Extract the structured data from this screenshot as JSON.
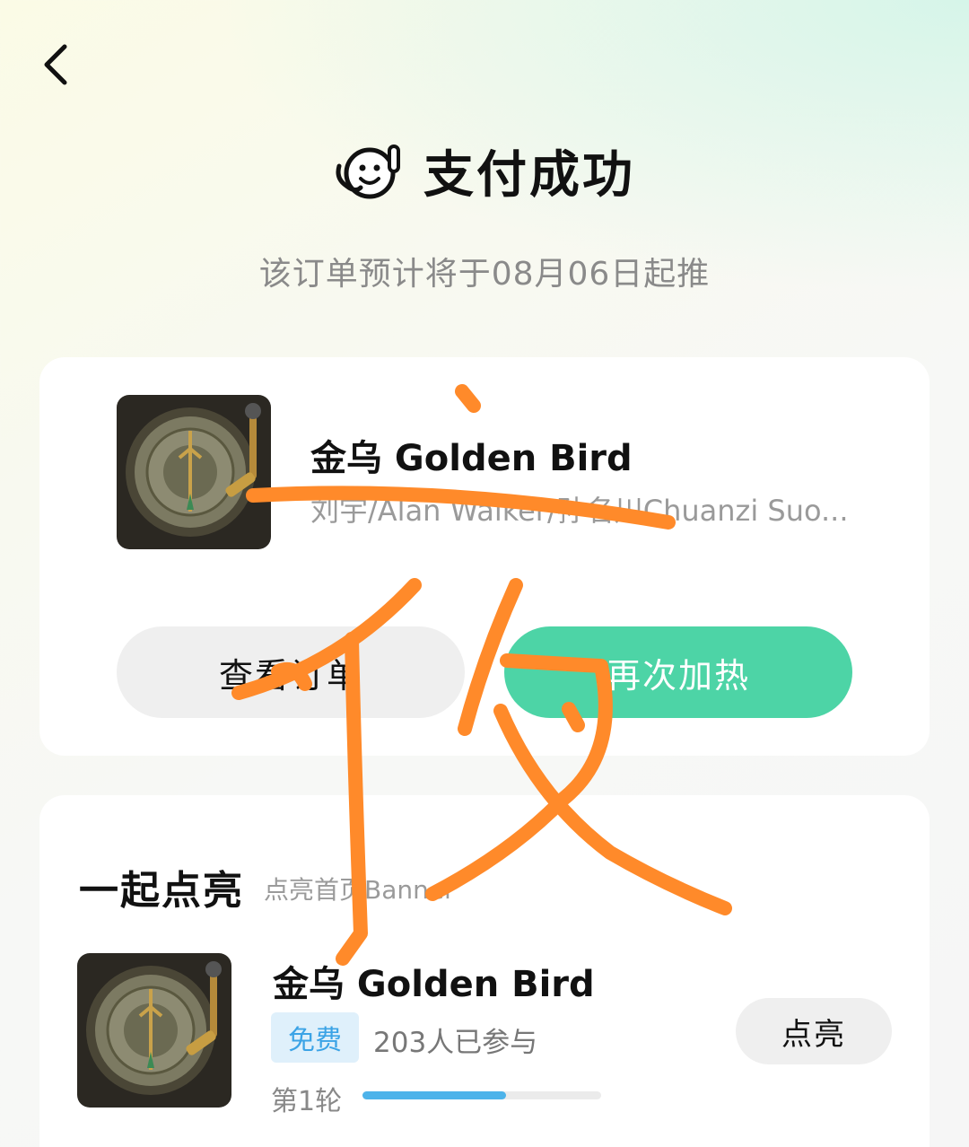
{
  "header": {
    "title": "支付成功",
    "subtitle": "该订单预计将于08月06日起推",
    "back_icon": "chevron-left-icon",
    "mascot_icon": "waving-mascot-icon"
  },
  "order": {
    "song_title": "金乌 Golden Bird",
    "artist": "刘宇/Alan Walker/孙名川Chuanzi Suo...",
    "view_button": "查看订单",
    "heat_button": "再次加热"
  },
  "light_up": {
    "title": "一起点亮",
    "subtitle": "点亮首页Banner",
    "song_title": "金乌 Golden Bird",
    "badge": "免费",
    "participants": "203人已参与",
    "round": "第1轮",
    "progress": 0.6,
    "button": "点亮"
  },
  "colors": {
    "accent_green": "#4dd4a6",
    "badge_blue": "#3ba3e6",
    "progress_blue": "#4db3ea",
    "scribble_orange": "#ff8a2a"
  }
}
